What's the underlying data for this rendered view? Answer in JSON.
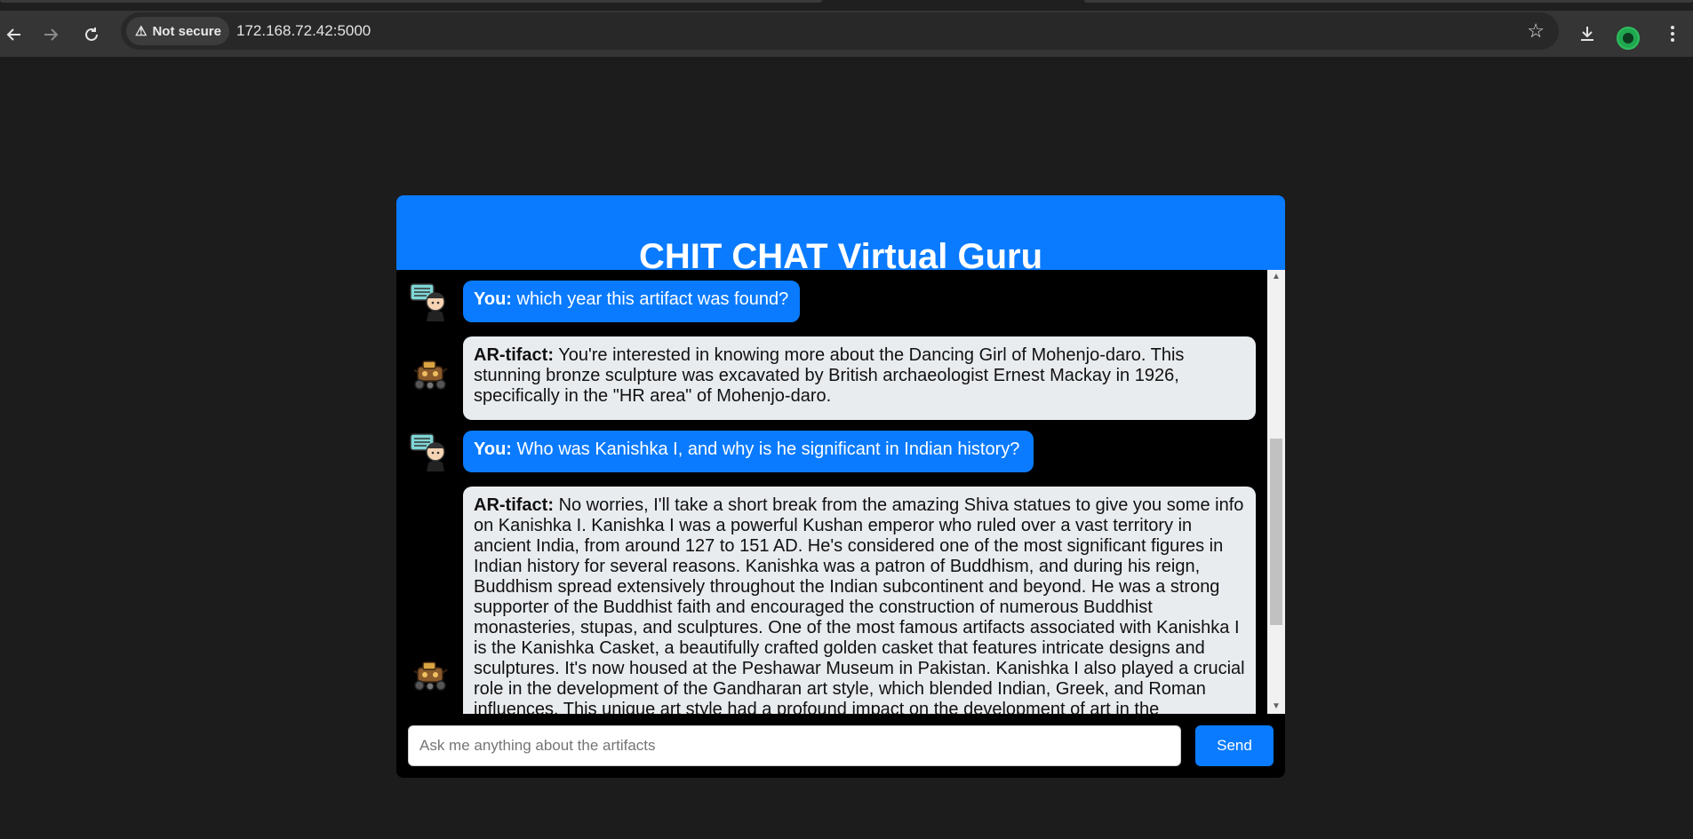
{
  "browser": {
    "back_icon": "arrow-left-icon",
    "forward_icon": "arrow-right-icon",
    "reload_icon": "reload-icon",
    "security_label": "Not secure",
    "url": "172.168.72.42:5000",
    "bookmark_icon": "star-icon",
    "download_icon": "download-icon",
    "menu_icon": "more-vertical-icon"
  },
  "chat": {
    "title": "CHIT CHAT Virtual Guru",
    "messages": [
      {
        "role": "user",
        "speaker": "You:",
        "text": "which year this artifact was found?"
      },
      {
        "role": "bot",
        "speaker": "AR-tifact:",
        "text": "You're interested in knowing more about the Dancing Girl of Mohenjo-daro. This stunning bronze sculpture was excavated by British archaeologist Ernest Mackay in 1926, specifically in the \"HR area\" of Mohenjo-daro."
      },
      {
        "role": "user",
        "speaker": "You:",
        "text": "Who was Kanishka I, and why is he significant in Indian history?"
      },
      {
        "role": "bot",
        "speaker": "AR-tifact:",
        "text": "No worries, I'll take a short break from the amazing Shiva statues to give you some info on Kanishka I. Kanishka I was a powerful Kushan emperor who ruled over a vast territory in ancient India, from around 127 to 151 AD. He's considered one of the most significant figures in Indian history for several reasons. Kanishka was a patron of Buddhism, and during his reign, Buddhism spread extensively throughout the Indian subcontinent and beyond. He was a strong supporter of the Buddhist faith and encouraged the construction of numerous Buddhist monasteries, stupas, and sculptures. One of the most famous artifacts associated with Kanishka I is the Kanishka Casket, a beautifully crafted golden casket that features intricate designs and sculptures. It's now housed at the Peshawar Museum in Pakistan. Kanishka I also played a crucial role in the development of the Gandharan art style, which blended Indian, Greek, and Roman influences. This unique art style had a profound impact on the development of art in the"
      }
    ],
    "input_placeholder": "Ask me anything about the artifacts",
    "input_value": "",
    "send_label": "Send"
  },
  "colors": {
    "page_bg": "#1c1c1c",
    "accent": "#0a7bfe",
    "bot_bubble": "#e9ecef"
  }
}
